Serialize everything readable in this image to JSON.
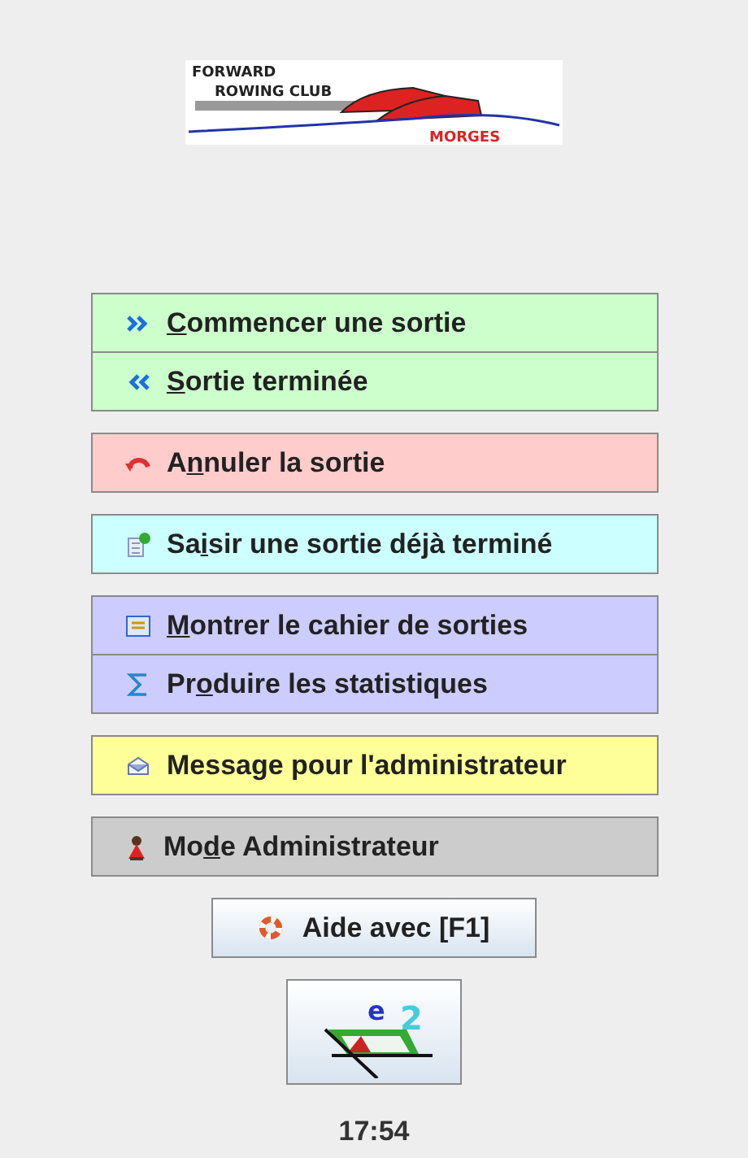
{
  "logo": {
    "line_1": "FORWARD",
    "line_2": "ROWING CLUB",
    "place": "MORGES"
  },
  "groups": [
    {
      "color": "#ccffcc",
      "items": [
        {
          "kind": "start",
          "label": {
            "underlined": "C",
            "after": "ommencer une sortie"
          }
        },
        {
          "kind": "finish",
          "label": {
            "underlined": "S",
            "after": "ortie terminée"
          }
        }
      ]
    },
    {
      "color": "#ffcccc",
      "items": [
        {
          "kind": "cancel",
          "label": {
            "before": "A",
            "underlined": "n",
            "after": "nuler la sortie"
          }
        }
      ]
    },
    {
      "color": "#ccffff",
      "items": [
        {
          "kind": "enter",
          "label": {
            "before": "Sa",
            "underlined": "i",
            "after": "sir une sortie déjà terminé"
          }
        }
      ]
    },
    {
      "color": "#ccccff",
      "items": [
        {
          "kind": "logbook",
          "label": {
            "underlined": "M",
            "after": "ontrer le cahier de sorties"
          }
        },
        {
          "kind": "stats",
          "label": {
            "before": "Pr",
            "underlined": "o",
            "after": "duire les statistiques"
          }
        }
      ]
    },
    {
      "color": "#ffff99",
      "items": [
        {
          "kind": "message",
          "label": {
            "before": "Message pour l'administrateur"
          }
        }
      ]
    },
    {
      "color": "#cccccc",
      "items": [
        {
          "kind": "admin",
          "label": {
            "before": "Mo",
            "underlined": "d",
            "after": "e Administrateur"
          }
        }
      ]
    }
  ],
  "help_button": {
    "label": "Aide avec [F1]"
  },
  "efa_logo": {
    "letter": "e",
    "digit": "2"
  },
  "clock": "17:54"
}
